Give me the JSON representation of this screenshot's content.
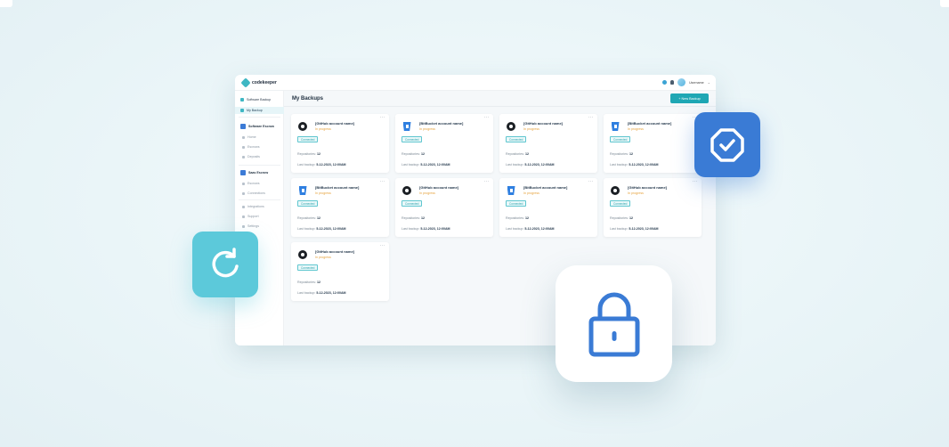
{
  "app": {
    "logo_text": "codekeeper",
    "username": "Username"
  },
  "sidebar": {
    "items": [
      {
        "label": "Software Backup",
        "kind": "section"
      },
      {
        "label": "My Backup",
        "kind": "active"
      },
      {
        "label": "Software Escrow",
        "kind": "section-bold"
      },
      {
        "label": "Home",
        "kind": "sub"
      },
      {
        "label": "Escrows",
        "kind": "sub"
      },
      {
        "label": "Deposits",
        "kind": "sub"
      },
      {
        "label": "Saas Escrow",
        "kind": "section-bold"
      },
      {
        "label": "Escrows",
        "kind": "sub"
      },
      {
        "label": "Connections",
        "kind": "sub"
      },
      {
        "label": "Integrations",
        "kind": "sub"
      },
      {
        "label": "Support",
        "kind": "sub"
      },
      {
        "label": "Settings",
        "kind": "sub"
      }
    ]
  },
  "main": {
    "title": "My Backups",
    "new_button": "+ New Backup",
    "cards": [
      {
        "provider": "github",
        "name": "[GitHub account name]",
        "status": "In progress",
        "badge": "Connected",
        "repos_label": "Repositories:",
        "repos": "12",
        "last_label": "Last backup:",
        "last": "5-12-2023, 12:00AM"
      },
      {
        "provider": "bitbucket",
        "name": "[BitBucket account name]",
        "status": "In progress",
        "badge": "Connected",
        "repos_label": "Repositories:",
        "repos": "12",
        "last_label": "Last backup:",
        "last": "5-12-2023, 12:00AM"
      },
      {
        "provider": "github",
        "name": "[GitHub account name]",
        "status": "In progress",
        "badge": "Connected",
        "repos_label": "Repositories:",
        "repos": "12",
        "last_label": "Last backup:",
        "last": "5-12-2023, 12:00AM"
      },
      {
        "provider": "bitbucket",
        "name": "[BitBucket account name]",
        "status": "In progress",
        "badge": "Connected",
        "repos_label": "Repositories:",
        "repos": "12",
        "last_label": "Last backup:",
        "last": "5-12-2023, 12:00AM"
      },
      {
        "provider": "bitbucket",
        "name": "[BitBucket account name]",
        "status": "In progress",
        "badge": "Connected",
        "repos_label": "Repositories:",
        "repos": "12",
        "last_label": "Last backup:",
        "last": "5-12-2023, 12:00AM"
      },
      {
        "provider": "github",
        "name": "[GitHub account name]",
        "status": "In progress",
        "badge": "Connected",
        "repos_label": "Repositories:",
        "repos": "12",
        "last_label": "Last backup:",
        "last": "5-12-2023, 12:00AM"
      },
      {
        "provider": "bitbucket",
        "name": "[BitBucket account name]",
        "status": "In progress",
        "badge": "Connected",
        "repos_label": "Repositories:",
        "repos": "12",
        "last_label": "Last backup:",
        "last": "5-12-2023, 12:00AM"
      },
      {
        "provider": "github",
        "name": "[GitHub account name]",
        "status": "In progress",
        "badge": "Connected",
        "repos_label": "Repositories:",
        "repos": "12",
        "last_label": "Last backup:",
        "last": "5-12-2023, 12:00AM"
      },
      {
        "provider": "github",
        "name": "[GitHub account name]",
        "status": "In progress",
        "badge": "Connected",
        "repos_label": "Repositories:",
        "repos": "12",
        "last_label": "Last backup:",
        "last": "5-12-2023, 12:00AM"
      }
    ]
  },
  "decor": {
    "shield_icon": "shield-check-icon",
    "refresh_icon": "refresh-icon",
    "lock_icon": "lock-icon",
    "accent": "#1fa7b4",
    "blue": "#3a7bd5",
    "cyan": "#5cc9da"
  }
}
